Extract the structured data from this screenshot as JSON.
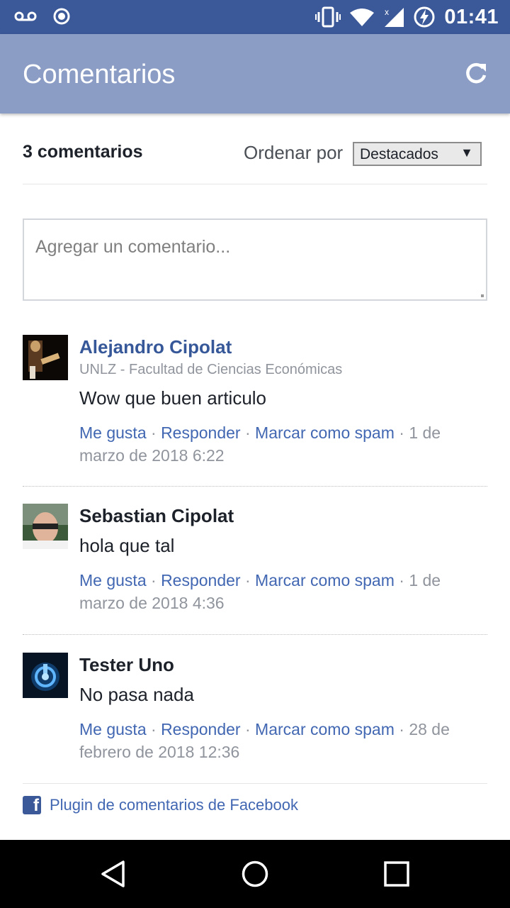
{
  "status_bar": {
    "time": "01:41",
    "icons": [
      "voicemail-icon",
      "record-icon",
      "vibrate-icon",
      "wifi-icon",
      "signal-icon",
      "battery-charging-icon"
    ]
  },
  "app_bar": {
    "title": "Comentarios",
    "refresh_icon": "refresh-icon"
  },
  "comments_header": {
    "count": "3 comentarios",
    "sort_label": "Ordenar por",
    "sort_selected": "Destacados",
    "sort_arrow": "▼"
  },
  "composer": {
    "placeholder": "Agregar un comentario..."
  },
  "comments": [
    {
      "author": "Alejandro Cipolat",
      "affiliation": "UNLZ - Facultad de Ciencias Económicas",
      "text": "Wow que buen articulo",
      "like": "Me gusta",
      "reply": "Responder",
      "spam": "Marcar como spam",
      "date": "1 de marzo de 2018 6:22"
    },
    {
      "author": "Sebastian Cipolat",
      "text": "hola que tal",
      "like": "Me gusta",
      "reply": "Responder",
      "spam": "Marcar como spam",
      "date": "1 de marzo de 2018 4:36"
    },
    {
      "author": "Tester Uno",
      "text": "No pasa nada",
      "like": "Me gusta",
      "reply": "Responder",
      "spam": "Marcar como spam",
      "date": "28 de febrero de 2018 12:36"
    }
  ],
  "separator": "·",
  "footer": {
    "label": "Plugin de comentarios de Facebook",
    "icon_letter": "f"
  },
  "nav_bar": {
    "buttons": [
      "back-icon",
      "home-icon",
      "recents-icon"
    ]
  },
  "colors": {
    "status_bar": "#3b5898",
    "app_bar": "#8b9dc5",
    "link": "#4267b2",
    "author_link": "#365899",
    "meta": "#90949c"
  }
}
